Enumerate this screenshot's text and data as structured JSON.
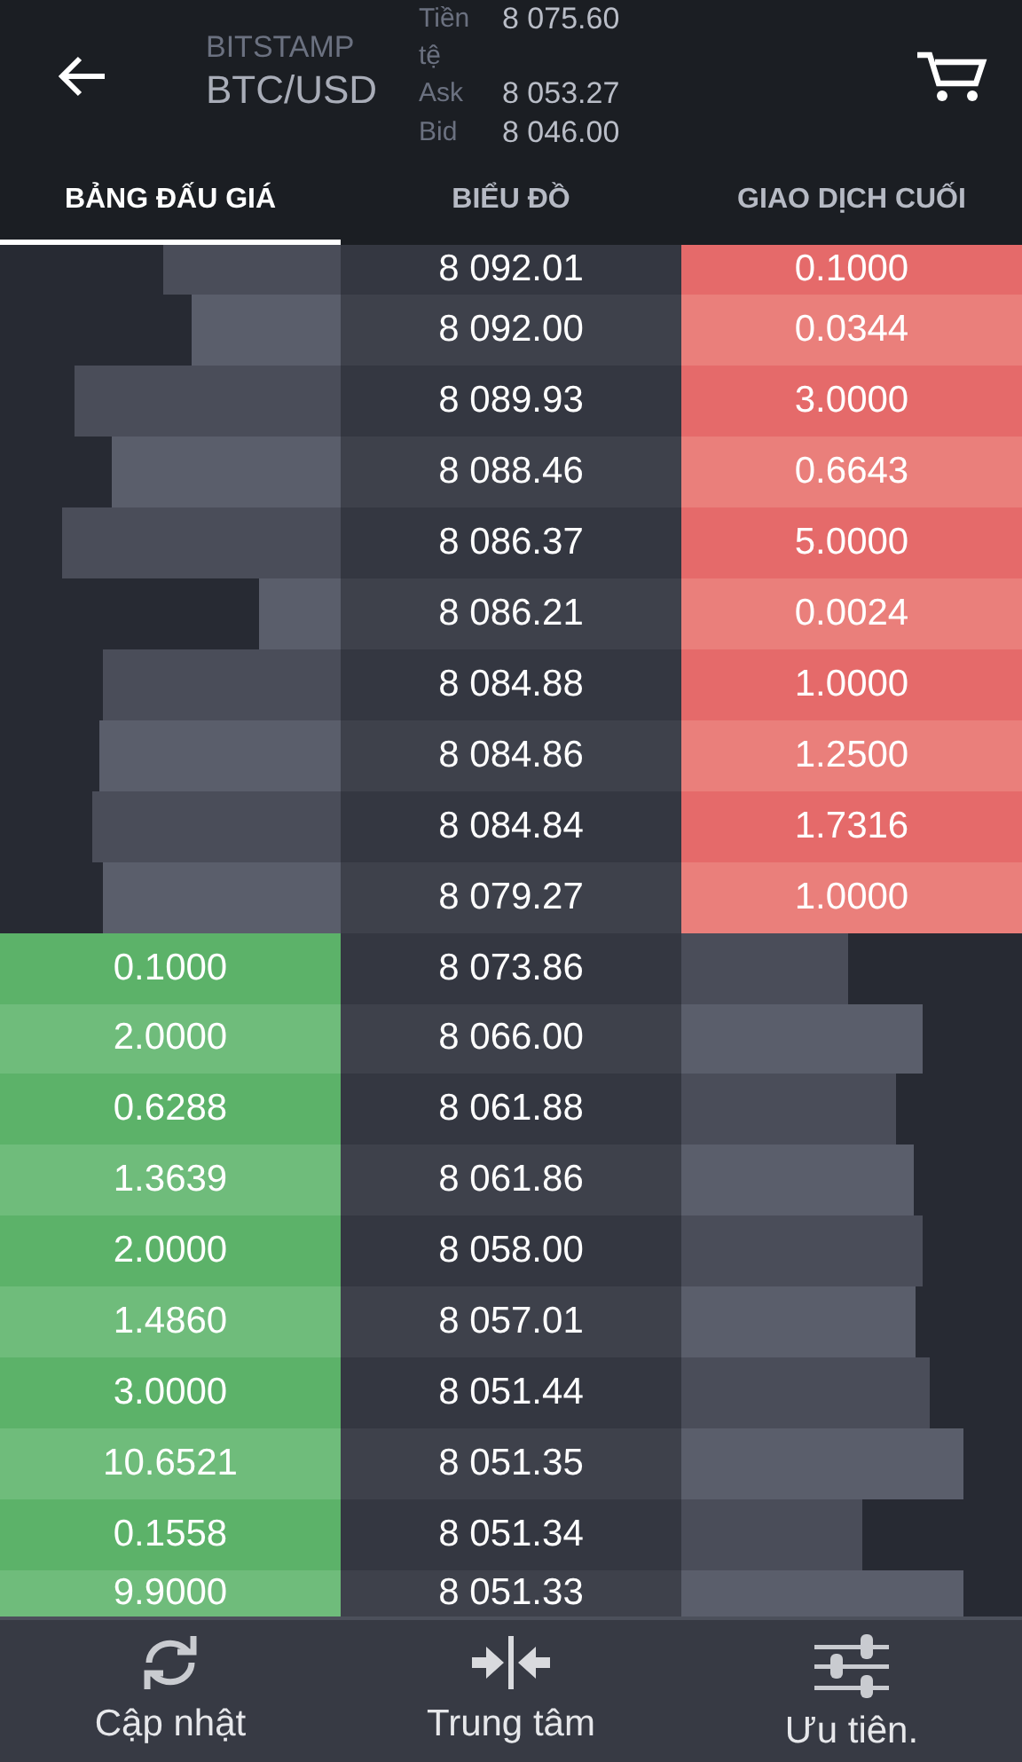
{
  "header": {
    "exchange": "BITSTAMP",
    "pair": "BTC/USD",
    "stats": [
      {
        "label": "Tiền tệ",
        "value": "8 075.60"
      },
      {
        "label": "Ask",
        "value": "8 053.27"
      },
      {
        "label": "Bid",
        "value": "8 046.00"
      }
    ]
  },
  "tabs": [
    {
      "label": "BẢNG ĐẤU GIÁ",
      "selected": true
    },
    {
      "label": "BIỂU ĐỒ",
      "selected": false
    },
    {
      "label": "GIAO DỊCH CUỐI",
      "selected": false
    }
  ],
  "asks": [
    {
      "price": "8 092.01",
      "amount": "0.1000",
      "level": 0.52
    },
    {
      "price": "8 092.00",
      "amount": "0.0344",
      "level": 0.44
    },
    {
      "price": "8 089.93",
      "amount": "3.0000",
      "level": 0.78
    },
    {
      "price": "8 088.46",
      "amount": "0.6643",
      "level": 0.67
    },
    {
      "price": "8 086.37",
      "amount": "5.0000",
      "level": 0.82
    },
    {
      "price": "8 086.21",
      "amount": "0.0024",
      "level": 0.24
    },
    {
      "price": "8 084.88",
      "amount": "1.0000",
      "level": 0.7
    },
    {
      "price": "8 084.86",
      "amount": "1.2500",
      "level": 0.71
    },
    {
      "price": "8 084.84",
      "amount": "1.7316",
      "level": 0.73
    },
    {
      "price": "8 079.27",
      "amount": "1.0000",
      "level": 0.7
    }
  ],
  "bids": [
    {
      "price": "8 073.86",
      "amount": "0.1000",
      "level": 0.49
    },
    {
      "price": "8 066.00",
      "amount": "2.0000",
      "level": 0.71
    },
    {
      "price": "8 061.88",
      "amount": "0.6288",
      "level": 0.63
    },
    {
      "price": "8 061.86",
      "amount": "1.3639",
      "level": 0.68
    },
    {
      "price": "8 058.00",
      "amount": "2.0000",
      "level": 0.71
    },
    {
      "price": "8 057.01",
      "amount": "1.4860",
      "level": 0.69
    },
    {
      "price": "8 051.44",
      "amount": "3.0000",
      "level": 0.73
    },
    {
      "price": "8 051.35",
      "amount": "10.6521",
      "level": 0.83
    },
    {
      "price": "8 051.34",
      "amount": "0.1558",
      "level": 0.53
    },
    {
      "price": "8 051.33",
      "amount": "9.9000",
      "level": 0.83
    }
  ],
  "bottom_bar": [
    {
      "kind": "refresh",
      "label": "Cập nhật"
    },
    {
      "kind": "center",
      "label": "Trung tâm"
    },
    {
      "kind": "settings",
      "label": "Ưu tiên."
    }
  ]
}
